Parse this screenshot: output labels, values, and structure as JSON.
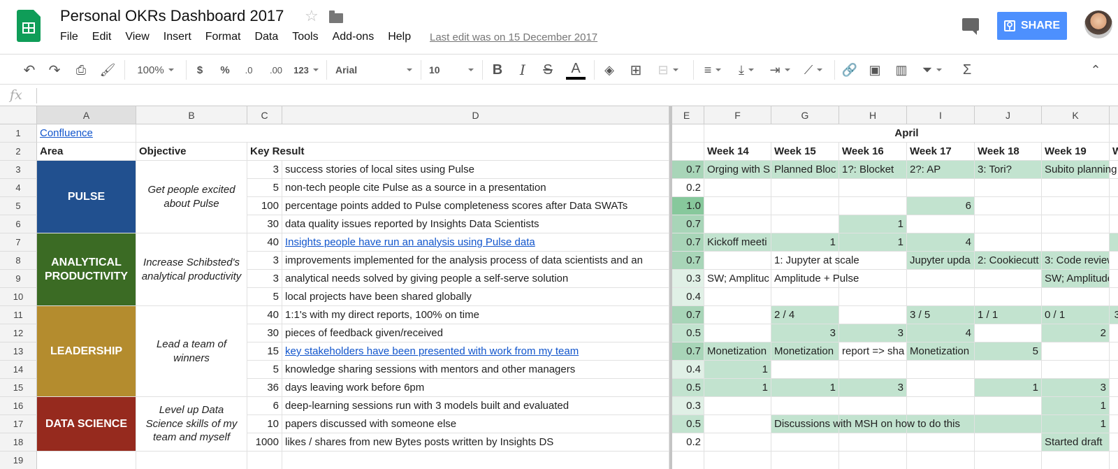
{
  "window": {
    "title": "Personal OKRs Dashboard 2017",
    "last_edit": "Last edit was on 15 December 2017",
    "share_label": "SHARE"
  },
  "menu": [
    "File",
    "Edit",
    "View",
    "Insert",
    "Format",
    "Data",
    "Tools",
    "Add-ons",
    "Help"
  ],
  "toolbar": {
    "zoom": "100%",
    "currency": "$",
    "percent": "%",
    "dec_less": ".0",
    "dec_more": ".00",
    "format_more": "123",
    "font": "Arial",
    "font_size": "10"
  },
  "formula": {
    "fx": "fx",
    "value": ""
  },
  "columns": [
    "A",
    "B",
    "C",
    "D",
    "E",
    "F",
    "G",
    "H",
    "I",
    "J",
    "K"
  ],
  "rows": [
    "1",
    "2",
    "3",
    "4",
    "5",
    "6",
    "7",
    "8",
    "9",
    "10",
    "11",
    "12",
    "13",
    "14",
    "15",
    "16",
    "17",
    "18",
    "19"
  ],
  "sheet": {
    "link_a1": "Confluence",
    "month": "April",
    "headers": {
      "area": "Area",
      "objective": "Objective",
      "key_result": "Key Result"
    },
    "weeks": [
      "Week 14",
      "Week 15",
      "Week 16",
      "Week 17",
      "Week 18",
      "Week 19",
      "W"
    ],
    "areas": [
      {
        "name": "PULSE",
        "color": "#21508f",
        "objective": "Get people excited about Pulse"
      },
      {
        "name": "ANALYTICAL PRODUCTIVITY",
        "color": "#3b6b24",
        "objective": "Increase Schibsted's analytical productivity"
      },
      {
        "name": "LEADERSHIP",
        "color": "#b48c2e",
        "objective": "Lead a team of winners"
      },
      {
        "name": "DATA SCIENCE",
        "color": "#962a1e",
        "objective": "Level up Data Science skills of my team and myself"
      }
    ],
    "key_results": [
      {
        "target": "3",
        "text": "success stories of local sites using Pulse",
        "score": "0.7",
        "weeks": [
          "Orging with S",
          "Planned Bloc",
          "1?: Blocket",
          "2?: AP",
          "3: Tori?",
          "Subito planning",
          ""
        ]
      },
      {
        "target": "5",
        "text": "non-tech people cite Pulse as a source in a presentation",
        "score": "0.2",
        "weeks": [
          "",
          "",
          "",
          "",
          "",
          "",
          ""
        ]
      },
      {
        "target": "100",
        "text": "percentage points added to Pulse completeness scores after Data SWATs",
        "score": "1.0",
        "weeks": [
          "",
          "",
          "",
          "6",
          "",
          "",
          ""
        ]
      },
      {
        "target": "30",
        "text": "data quality issues reported by Insights Data Scientists",
        "score": "0.7",
        "weeks": [
          "",
          "",
          "1",
          "",
          "",
          "",
          ""
        ]
      },
      {
        "target": "40",
        "text": "Insights people have run an analysis using Pulse data",
        "score": "0.7",
        "weeks": [
          "Kickoff meeti",
          "1",
          "1",
          "4",
          "",
          "",
          ""
        ]
      },
      {
        "target": "3",
        "text": "improvements implemented for the analysis process of data scientists and an",
        "score": "0.7",
        "weeks": [
          "",
          "1: Jupyter at scale",
          "",
          "Jupyter upda",
          "2: Cookiecutt",
          "3: Code review",
          ""
        ]
      },
      {
        "target": "3",
        "text": "analytical needs solved by giving people a self-serve solution",
        "score": "0.3",
        "weeks": [
          "SW; Amplituc",
          "Amplitude + Pulse",
          "",
          "",
          "",
          "SW; Amplitude",
          ""
        ]
      },
      {
        "target": "5",
        "text": "local projects have been shared globally",
        "score": "0.4",
        "weeks": [
          "",
          "",
          "",
          "",
          "",
          "",
          ""
        ]
      },
      {
        "target": "40",
        "text": "1:1's with my direct reports, 100% on time",
        "score": "0.7",
        "weeks": [
          "",
          "2 / 4",
          "",
          "3 / 5",
          "1 / 1",
          "0 / 1",
          "3"
        ]
      },
      {
        "target": "30",
        "text": "pieces of feedback given/received",
        "score": "0.5",
        "weeks": [
          "",
          "3",
          "3",
          "4",
          "",
          "2",
          ""
        ]
      },
      {
        "target": "15",
        "text": "key stakeholders have been presented with work from my team",
        "score": "0.7",
        "weeks": [
          "Monetization",
          "Monetization",
          "report => sha",
          "Monetization",
          "5",
          "",
          ""
        ]
      },
      {
        "target": "5",
        "text": "knowledge sharing sessions with mentors and other managers",
        "score": "0.4",
        "weeks": [
          "1",
          "",
          "",
          "",
          "",
          "",
          ""
        ]
      },
      {
        "target": "36",
        "text": "days leaving work before 6pm",
        "score": "0.5",
        "weeks": [
          "1",
          "1",
          "3",
          "",
          "1",
          "3",
          ""
        ]
      },
      {
        "target": "6",
        "text": "deep-learning sessions run with 3 models built and evaluated",
        "score": "0.3",
        "weeks": [
          "",
          "",
          "",
          "",
          "",
          "1",
          ""
        ]
      },
      {
        "target": "10",
        "text": "papers discussed with someone else",
        "score": "0.5",
        "weeks": [
          "",
          "Discussions with MSH on how to do this",
          "",
          "",
          "",
          "1",
          ""
        ]
      },
      {
        "target": "1000",
        "text": "likes / shares from new Bytes posts written by Insights DS",
        "score": "0.2",
        "weeks": [
          "",
          "",
          "",
          "",
          "",
          "Started draft",
          ""
        ]
      }
    ]
  }
}
